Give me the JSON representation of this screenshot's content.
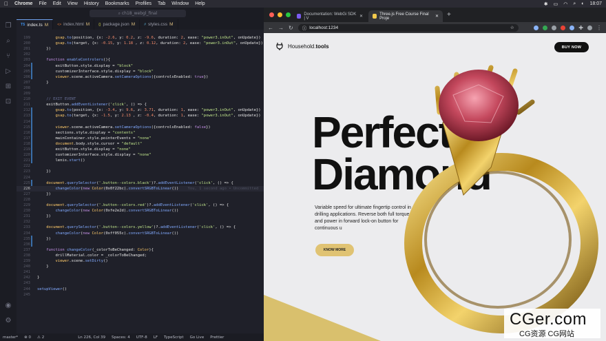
{
  "menubar": {
    "app": "Chrome",
    "items": [
      "File",
      "Edit",
      "View",
      "History",
      "Bookmarks",
      "Profiles",
      "Tab",
      "Window",
      "Help"
    ],
    "clock": "18:07"
  },
  "vscode": {
    "search_text": "ch18_webgl_final",
    "tabs": [
      {
        "icon": "TS",
        "label": "index.ts",
        "mod": "M",
        "active": true
      },
      {
        "icon": "<>",
        "label": "index.html",
        "mod": "M",
        "active": false
      },
      {
        "icon": "{}",
        "label": "package.json",
        "mod": "M",
        "active": false
      },
      {
        "icon": "#",
        "label": "styles.css",
        "mod": "M",
        "active": false
      }
    ],
    "current_line": 226,
    "ghost_text": "You, 1 second ago • Uncommitted",
    "status": {
      "branch": "master*",
      "errors": "⊗ 0",
      "warnings": "⚠ 2",
      "cursor": "Ln 226, Col 39",
      "spaces": "Spaces: 4",
      "encoding": "UTF-8",
      "eol": "LF",
      "language": "TypeScript",
      "golive": "Go Live",
      "prettier": "Prettier"
    },
    "code": [
      {
        "n": "199",
        "t": "        gsap.to(position, {x: -2.6, y: 0.2, z: -9.6, duration: 2, ease: \"power3.inOut\", onUpdate})"
      },
      {
        "n": "200",
        "t": "        gsap.to(target, {x: -0.15, y: 1.18 , z: 0.12, duration: 2, ease: \"power3.inOut\", onUpdate})"
      },
      {
        "n": "201",
        "t": "    })"
      },
      {
        "n": "202",
        "t": ""
      },
      {
        "n": "203",
        "t": "    function enableControlers(){"
      },
      {
        "n": "204",
        "t": "        exitButton.style.display = \"block\""
      },
      {
        "n": "205",
        "t": "        customizerInterface.style.display = \"block\""
      },
      {
        "n": "206",
        "t": "        viewer.scene.activeCamera.setCameraOptions({controlsEnabled: true})"
      },
      {
        "n": "207",
        "t": "    }"
      },
      {
        "n": "208",
        "t": ""
      },
      {
        "n": "209",
        "t": ""
      },
      {
        "n": "210",
        "t": "    // EXIT EVENT"
      },
      {
        "n": "211",
        "t": "    exitButton.addEventListener('click', () => {"
      },
      {
        "n": "212",
        "t": "        gsap.to(position, {x: -3.4, y: 9.6, z: 3.71, duration: 1, ease: \"power3.inOut\", onUpdate})"
      },
      {
        "n": "213",
        "t": "        gsap.to(target, {x: -1.5, y: 2.13 , z: -0.4, duration: 1, ease: \"power3.inOut\", onUpdate})"
      },
      {
        "n": "214",
        "t": ""
      },
      {
        "n": "215",
        "t": "        viewer.scene.activeCamera.setCameraOptions({controlsEnabled: false})"
      },
      {
        "n": "216",
        "t": "        sections.style.display = \"contents\""
      },
      {
        "n": "217",
        "t": "        mainContainer.style.pointerEvents = \"none\""
      },
      {
        "n": "218",
        "t": "        document.body.style.cursor = \"default\""
      },
      {
        "n": "219",
        "t": "        exitButton.style.display = \"none\""
      },
      {
        "n": "220",
        "t": "        customizerInterface.style.display = \"none\""
      },
      {
        "n": "221",
        "t": "        lenis.start()"
      },
      {
        "n": "222",
        "t": ""
      },
      {
        "n": "223",
        "t": "    })"
      },
      {
        "n": "224",
        "t": ""
      },
      {
        "n": "225",
        "t": "    document.querySelector('.button--colors.black')?.addEventListener('click', () => {"
      },
      {
        "n": "226",
        "t": "        changeColor(new Color(0x0f22bc).convertSRGBToLinear())"
      },
      {
        "n": "227",
        "t": "    })"
      },
      {
        "n": "228",
        "t": ""
      },
      {
        "n": "229",
        "t": "    document.querySelector('.button--colors.red')?.addEventListener('click', () => {"
      },
      {
        "n": "230",
        "t": "        changeColor(new Color(0xfe2e2d).convertSRGBToLinear())"
      },
      {
        "n": "231",
        "t": "    })"
      },
      {
        "n": "232",
        "t": ""
      },
      {
        "n": "233",
        "t": "    document.querySelector('.button--colors.yellow')?.addEventListener('click', () => {"
      },
      {
        "n": "234",
        "t": "        changeColor(new Color(0xff055c).convertSRGBToLinear())"
      },
      {
        "n": "235",
        "t": "    })"
      },
      {
        "n": "236",
        "t": ""
      },
      {
        "n": "237",
        "t": "    function changeColor(_colorToBeChanged: Color){"
      },
      {
        "n": "238",
        "t": "        drillMaterial.color = _colorToBeChanged;"
      },
      {
        "n": "239",
        "t": "        viewer.scene.setDirty()"
      },
      {
        "n": "240",
        "t": "    }"
      },
      {
        "n": "241",
        "t": ""
      },
      {
        "n": "242",
        "t": "}"
      },
      {
        "n": "243",
        "t": ""
      },
      {
        "n": "244",
        "t": "setupViewer()"
      },
      {
        "n": "245",
        "t": ""
      }
    ]
  },
  "chrome": {
    "tabs": [
      {
        "label": "Documentation: WebGi SDK | V",
        "fav_color": "#7b5cf0",
        "active": false
      },
      {
        "label": "Three.js Free Course Final Proje",
        "fav_color": "#f2c94c",
        "active": true
      }
    ],
    "url": "localhost:1234",
    "ext_colors": [
      "#8ab4f8",
      "#34a853",
      "#9aa0a6",
      "#ea4335",
      "#8ab4f8",
      "#9aa0a6"
    ]
  },
  "site": {
    "logo_prefix": "Household.",
    "logo_suffix": "tools",
    "buy_label": "BUY NOW",
    "hero_line1": "Perfect",
    "hero_line2": "Diamond",
    "paragraph": "Variable speed for ultimate fingertip control in all drilling applications. Reverse both full torque and power in forward lock-on button for continuous u",
    "cta_label": "KNOW MORE",
    "accent_color": "#e0c373"
  },
  "watermark": {
    "line1": "CGer.com",
    "line2": "CG资源  CG网站"
  }
}
